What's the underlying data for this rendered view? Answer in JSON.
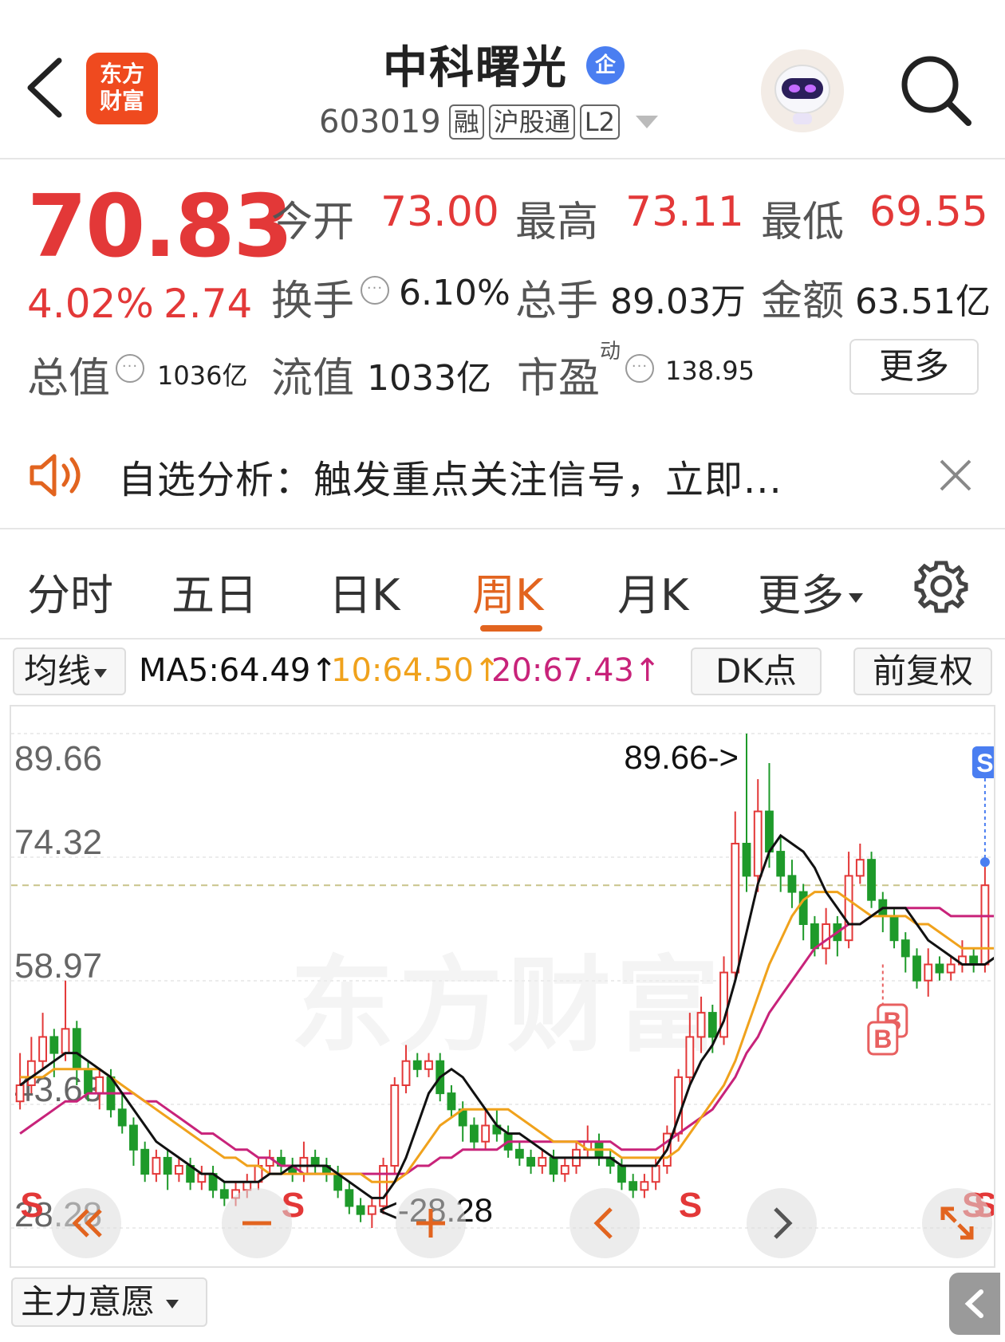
{
  "header": {
    "logo_line1": "东方",
    "logo_line2": "财富",
    "stock_name": "中科曙光",
    "ent_badge": "企",
    "code": "603019",
    "tags": [
      "融",
      "沪股通",
      "L2"
    ]
  },
  "quote": {
    "price": "70.83",
    "change_pct": "4.02%",
    "change_amt": "2.74",
    "open_label": "今开",
    "open": "73.00",
    "high_label": "最高",
    "high": "73.11",
    "low_label": "最低",
    "low": "69.55",
    "turnover_label": "换手",
    "turnover": "6.10%",
    "volume_label": "总手",
    "volume": "89.03万",
    "amount_label": "金额",
    "amount": "63.51亿",
    "total_cap_label": "总值",
    "total_cap": "1036亿",
    "float_cap_label": "流值",
    "float_cap": "1033亿",
    "pe_label": "市盈",
    "pe_sup": "动",
    "pe": "138.95",
    "more_label": "更多",
    "info_dot": "···"
  },
  "notice": {
    "text": "自选分析：触发重点关注信号，立即..."
  },
  "tabs": [
    {
      "label": "分时"
    },
    {
      "label": "五日"
    },
    {
      "label": "日K"
    },
    {
      "label": "周K"
    },
    {
      "label": "月K"
    },
    {
      "label": "更多"
    }
  ],
  "active_tab": "周K",
  "ma_row": {
    "select_label": "均线",
    "ma5": "MA5:64.49↑",
    "ma10": "10:64.50↑",
    "ma20": "20:67.43↑",
    "dk_label": "DK点",
    "fq_label": "前复权"
  },
  "colors": {
    "up": "#e33838",
    "down": "#1e9a2a",
    "ma5": "#111111",
    "ma10": "#f0a21c",
    "ma20": "#c8237a",
    "accent": "#e2641f"
  },
  "chart_data": {
    "type": "candlestick",
    "y_tick_labels": [
      "89.66",
      "74.32",
      "58.97",
      "43.63",
      "28.28"
    ],
    "ylim": [
      28.28,
      89.66
    ],
    "max_annotation": "89.66->",
    "min_annotation": "<-28.28",
    "watermark": "东方财富",
    "signals": [
      "S",
      "S",
      "S",
      "S",
      "S",
      "B",
      "B"
    ],
    "candles": [
      {
        "o": 44,
        "c": 46,
        "h": 50,
        "l": 43
      },
      {
        "o": 46,
        "c": 49,
        "h": 52,
        "l": 45
      },
      {
        "o": 49,
        "c": 52,
        "h": 55,
        "l": 48
      },
      {
        "o": 52,
        "c": 50,
        "h": 53,
        "l": 47
      },
      {
        "o": 50,
        "c": 53,
        "h": 59,
        "l": 49
      },
      {
        "o": 53,
        "c": 48,
        "h": 54,
        "l": 46
      },
      {
        "o": 48,
        "c": 45,
        "h": 49,
        "l": 44
      },
      {
        "o": 45,
        "c": 47,
        "h": 48,
        "l": 43
      },
      {
        "o": 47,
        "c": 43,
        "h": 48,
        "l": 42
      },
      {
        "o": 43,
        "c": 41,
        "h": 45,
        "l": 40
      },
      {
        "o": 41,
        "c": 38,
        "h": 42,
        "l": 36
      },
      {
        "o": 38,
        "c": 35,
        "h": 39,
        "l": 34
      },
      {
        "o": 35,
        "c": 37,
        "h": 38,
        "l": 34
      },
      {
        "o": 37,
        "c": 35,
        "h": 38,
        "l": 33
      },
      {
        "o": 35,
        "c": 36,
        "h": 37,
        "l": 34
      },
      {
        "o": 36,
        "c": 34,
        "h": 37,
        "l": 33
      },
      {
        "o": 34,
        "c": 35,
        "h": 36,
        "l": 33
      },
      {
        "o": 35,
        "c": 33,
        "h": 36,
        "l": 32
      },
      {
        "o": 33,
        "c": 32,
        "h": 34,
        "l": 31
      },
      {
        "o": 32,
        "c": 33,
        "h": 34,
        "l": 31
      },
      {
        "o": 33,
        "c": 34,
        "h": 35,
        "l": 32
      },
      {
        "o": 34,
        "c": 36,
        "h": 37,
        "l": 33
      },
      {
        "o": 36,
        "c": 37,
        "h": 38,
        "l": 35
      },
      {
        "o": 37,
        "c": 36,
        "h": 38,
        "l": 35
      },
      {
        "o": 36,
        "c": 35,
        "h": 37,
        "l": 34
      },
      {
        "o": 35,
        "c": 37,
        "h": 39,
        "l": 34
      },
      {
        "o": 37,
        "c": 36,
        "h": 38,
        "l": 35
      },
      {
        "o": 36,
        "c": 35,
        "h": 37,
        "l": 34
      },
      {
        "o": 35,
        "c": 33,
        "h": 36,
        "l": 32
      },
      {
        "o": 33,
        "c": 31,
        "h": 34,
        "l": 30
      },
      {
        "o": 31,
        "c": 30,
        "h": 32,
        "l": 29
      },
      {
        "o": 30,
        "c": 31,
        "h": 32,
        "l": 28.28
      },
      {
        "o": 31,
        "c": 36,
        "h": 37,
        "l": 30
      },
      {
        "o": 36,
        "c": 46,
        "h": 47,
        "l": 35
      },
      {
        "o": 46,
        "c": 49,
        "h": 51,
        "l": 45
      },
      {
        "o": 49,
        "c": 48,
        "h": 50,
        "l": 47
      },
      {
        "o": 48,
        "c": 49,
        "h": 50,
        "l": 47
      },
      {
        "o": 49,
        "c": 45,
        "h": 50,
        "l": 44
      },
      {
        "o": 45,
        "c": 43,
        "h": 46,
        "l": 42
      },
      {
        "o": 43,
        "c": 41,
        "h": 44,
        "l": 39
      },
      {
        "o": 41,
        "c": 39,
        "h": 42,
        "l": 38
      },
      {
        "o": 39,
        "c": 41,
        "h": 43,
        "l": 38
      },
      {
        "o": 41,
        "c": 40,
        "h": 43,
        "l": 39
      },
      {
        "o": 40,
        "c": 38,
        "h": 41,
        "l": 37
      },
      {
        "o": 38,
        "c": 37,
        "h": 39,
        "l": 36
      },
      {
        "o": 37,
        "c": 36,
        "h": 38,
        "l": 35
      },
      {
        "o": 36,
        "c": 37,
        "h": 38,
        "l": 35
      },
      {
        "o": 37,
        "c": 35,
        "h": 38,
        "l": 34
      },
      {
        "o": 35,
        "c": 36,
        "h": 37,
        "l": 34
      },
      {
        "o": 36,
        "c": 38,
        "h": 39,
        "l": 35
      },
      {
        "o": 38,
        "c": 39,
        "h": 41,
        "l": 37
      },
      {
        "o": 39,
        "c": 37,
        "h": 40,
        "l": 36
      },
      {
        "o": 37,
        "c": 36,
        "h": 38,
        "l": 35
      },
      {
        "o": 36,
        "c": 34,
        "h": 37,
        "l": 33
      },
      {
        "o": 34,
        "c": 33,
        "h": 35,
        "l": 32
      },
      {
        "o": 33,
        "c": 34,
        "h": 35,
        "l": 32
      },
      {
        "o": 34,
        "c": 36,
        "h": 37,
        "l": 33
      },
      {
        "o": 36,
        "c": 40,
        "h": 41,
        "l": 35
      },
      {
        "o": 40,
        "c": 47,
        "h": 48,
        "l": 39
      },
      {
        "o": 47,
        "c": 52,
        "h": 55,
        "l": 46
      },
      {
        "o": 52,
        "c": 55,
        "h": 57,
        "l": 50
      },
      {
        "o": 55,
        "c": 52,
        "h": 56,
        "l": 50
      },
      {
        "o": 52,
        "c": 60,
        "h": 62,
        "l": 51
      },
      {
        "o": 60,
        "c": 76,
        "h": 80,
        "l": 59
      },
      {
        "o": 76,
        "c": 72,
        "h": 89.66,
        "l": 70
      },
      {
        "o": 72,
        "c": 80,
        "h": 84,
        "l": 70
      },
      {
        "o": 80,
        "c": 75,
        "h": 86,
        "l": 73
      },
      {
        "o": 75,
        "c": 72,
        "h": 77,
        "l": 70
      },
      {
        "o": 72,
        "c": 70,
        "h": 74,
        "l": 68
      },
      {
        "o": 70,
        "c": 66,
        "h": 71,
        "l": 64
      },
      {
        "o": 66,
        "c": 63,
        "h": 67,
        "l": 62
      },
      {
        "o": 63,
        "c": 66,
        "h": 68,
        "l": 61
      },
      {
        "o": 66,
        "c": 64,
        "h": 67,
        "l": 62
      },
      {
        "o": 64,
        "c": 72,
        "h": 75,
        "l": 63
      },
      {
        "o": 72,
        "c": 74,
        "h": 76,
        "l": 71
      },
      {
        "o": 74,
        "c": 69,
        "h": 75,
        "l": 68
      },
      {
        "o": 69,
        "c": 67,
        "h": 70,
        "l": 65
      },
      {
        "o": 67,
        "c": 64,
        "h": 68,
        "l": 63
      },
      {
        "o": 64,
        "c": 62,
        "h": 65,
        "l": 60
      },
      {
        "o": 62,
        "c": 59,
        "h": 63,
        "l": 58
      },
      {
        "o": 59,
        "c": 61,
        "h": 63,
        "l": 57
      },
      {
        "o": 61,
        "c": 60,
        "h": 62,
        "l": 59
      },
      {
        "o": 60,
        "c": 61,
        "h": 62,
        "l": 59
      },
      {
        "o": 61,
        "c": 62,
        "h": 64,
        "l": 60
      },
      {
        "o": 62,
        "c": 61,
        "h": 63,
        "l": 60
      },
      {
        "o": 61,
        "c": 70.83,
        "h": 73.11,
        "l": 60
      }
    ],
    "ma5": [
      46,
      47,
      48,
      49,
      50,
      50,
      49,
      48,
      47,
      45,
      43,
      41,
      39,
      38,
      37,
      36,
      35,
      35,
      34,
      34,
      34,
      34,
      35,
      35,
      36,
      36,
      36,
      36,
      35,
      34,
      33,
      32,
      32,
      34,
      37,
      41,
      45,
      47,
      48,
      47,
      45,
      43,
      41,
      40,
      40,
      39,
      38,
      37,
      37,
      37,
      37,
      37,
      37,
      36,
      36,
      36,
      36,
      38,
      42,
      46,
      49,
      51,
      54,
      59,
      65,
      71,
      75,
      77,
      76,
      75,
      73,
      70,
      68,
      66,
      66,
      67,
      68,
      68,
      68,
      66,
      64,
      63,
      62,
      61,
      61,
      61,
      62,
      64
    ],
    "ma10": [
      47,
      47,
      47,
      48,
      48,
      48,
      48,
      48,
      47,
      46,
      45,
      44,
      43,
      42,
      41,
      40,
      39,
      38,
      37,
      37,
      36,
      36,
      35,
      35,
      35,
      35,
      35,
      35,
      35,
      35,
      35,
      34,
      34,
      34,
      35,
      37,
      39,
      41,
      42,
      43,
      43,
      43,
      43,
      43,
      42,
      41,
      40,
      39,
      39,
      39,
      38,
      38,
      38,
      37,
      37,
      37,
      37,
      37,
      38,
      40,
      42,
      44,
      46,
      49,
      53,
      57,
      61,
      64,
      67,
      69,
      70,
      70,
      70,
      69,
      68,
      67,
      67,
      67,
      67,
      66,
      66,
      65,
      64,
      63,
      63,
      63,
      63,
      64
    ],
    "ma20": [
      40,
      41,
      42,
      43,
      44,
      44,
      45,
      45,
      45,
      45,
      45,
      44,
      44,
      43,
      42,
      41,
      40,
      40,
      39,
      38,
      38,
      37,
      37,
      36,
      36,
      35,
      35,
      35,
      35,
      35,
      35,
      35,
      35,
      35,
      35,
      36,
      36,
      37,
      37,
      38,
      38,
      38,
      38,
      39,
      39,
      39,
      39,
      39,
      39,
      39,
      39,
      39,
      39,
      38,
      38,
      38,
      38,
      39,
      40,
      41,
      42,
      43,
      45,
      47,
      50,
      52,
      55,
      57,
      59,
      61,
      63,
      64,
      65,
      66,
      66,
      67,
      68,
      68,
      68,
      68,
      68,
      68,
      67,
      67,
      67,
      67,
      67,
      67.43
    ]
  },
  "bottom": {
    "select_label": "主力意愿"
  }
}
